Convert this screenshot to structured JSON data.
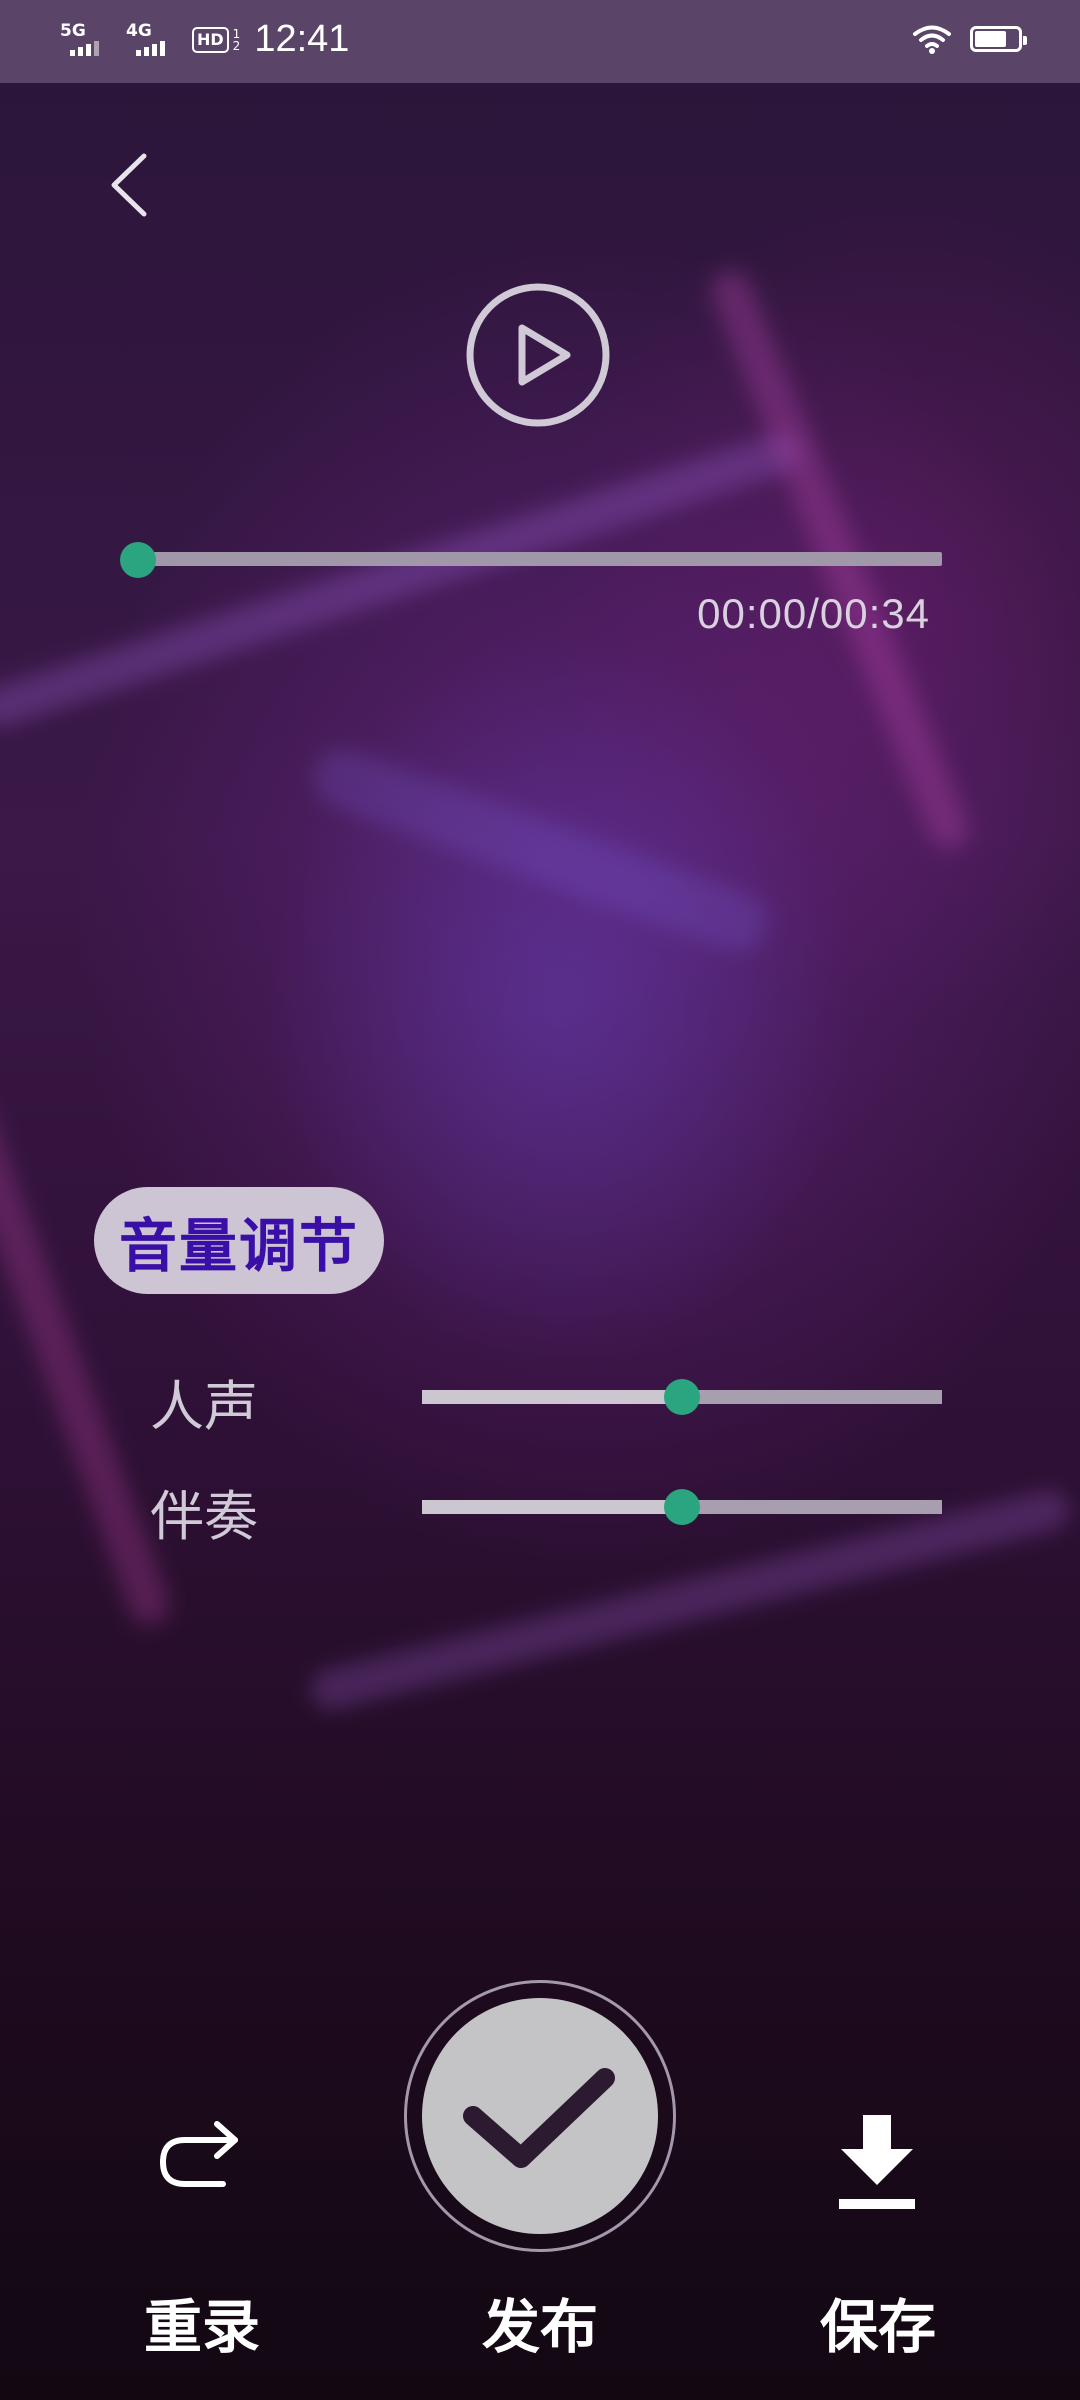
{
  "status_bar": {
    "sim1": "5G",
    "sim2": "4G",
    "hd_label": "HD",
    "hd_sub_1": "1",
    "hd_sub_2": "2",
    "time": "12:41",
    "battery_level": 0.75
  },
  "player": {
    "progress": 0.0,
    "timecode": "00:00/00:34"
  },
  "volume": {
    "title": "音量调节",
    "vocals": {
      "label": "人声",
      "level": 0.5
    },
    "accompaniment": {
      "label": "伴奏",
      "level": 0.5
    }
  },
  "actions": {
    "rerecord_label": "重录",
    "publish_label": "发布",
    "save_label": "保存"
  },
  "icons": {
    "back": "chevron-left-icon",
    "play": "play-icon",
    "rerecord": "redo-icon",
    "publish": "check-icon",
    "save": "download-icon"
  },
  "colors": {
    "accent": "#2aa57f",
    "pill_text": "#3a0fa8"
  }
}
